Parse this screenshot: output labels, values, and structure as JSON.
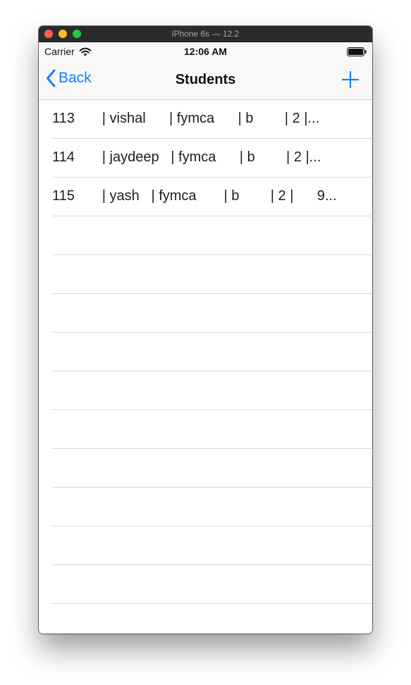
{
  "window": {
    "title": "iPhone 6s — 12.2"
  },
  "status_bar": {
    "carrier": "Carrier",
    "time": "12:06 AM",
    "icons": [
      "wifi-icon",
      "battery-icon"
    ]
  },
  "nav_bar": {
    "back_label": "Back",
    "title": "Students",
    "add_icon": "plus-icon"
  },
  "rows": [
    {
      "text": "113       | vishal      | fymca      | b        | 2 |..."
    },
    {
      "text": "114       | jaydeep   | fymca      | b        | 2 |..."
    },
    {
      "text": "115       | yash   | fymca       | b        | 2 |      9..."
    }
  ],
  "colors": {
    "tint": "#1a7ef5",
    "separator": "#d9d9d9",
    "bar_background": "#f8f8f8"
  }
}
